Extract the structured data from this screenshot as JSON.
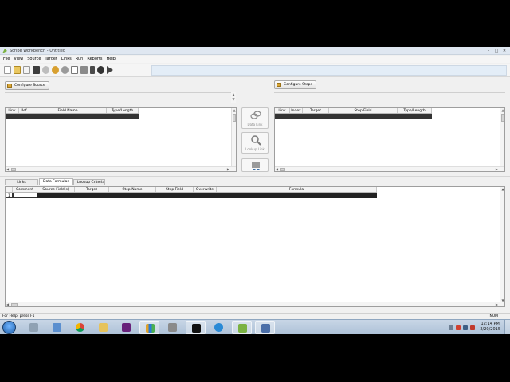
{
  "window": {
    "title": "Scribe Workbench - Untitled"
  },
  "menu": [
    "File",
    "View",
    "Source",
    "Target",
    "Links",
    "Run",
    "Reports",
    "Help"
  ],
  "toolbar": {
    "icons": [
      "new-icon",
      "open-icon",
      "open-recent-icon",
      "save-icon",
      "source-icon",
      "target-icon",
      "settings-icon",
      "report-icon",
      "print-icon",
      "flag-icon",
      "check-icon",
      "run-icon"
    ]
  },
  "source": {
    "configure_label": "Configure Source",
    "columns": [
      "Link",
      "Ref",
      "Field Name",
      "Type/Length"
    ]
  },
  "target": {
    "configure_label": "Configure Steps",
    "columns": [
      "Link",
      "Index",
      "Target",
      "Step Field",
      "Type/Length"
    ]
  },
  "center": {
    "data_link_label": "Data Link",
    "lookup_link_label": "Lookup Link"
  },
  "tabs": [
    {
      "label": "Links",
      "active": false
    },
    {
      "label": "Data Formulas",
      "active": true
    },
    {
      "label": "Lookup Criteria",
      "active": false
    }
  ],
  "formulas": {
    "columns": [
      "Comment",
      "Source Field(s)",
      "Target",
      "Step Name",
      "Step Field",
      "Overwrite",
      "Formula"
    ],
    "first_row_number": "1"
  },
  "status": {
    "help_text": "For Help, press F1",
    "num_indicator": "NUM"
  },
  "taskbar": {
    "time": "12:14 PM",
    "date": "2/20/2015",
    "apps": [
      "explorer-icon",
      "network-icon",
      "ie-icon",
      "chrome-icon",
      "folder-icon",
      "visual-studio-icon",
      "chart-app-icon",
      "network-tool-icon",
      "cmd-icon",
      "ie-blue-icon",
      "scribe-icon",
      "scribe-console-icon"
    ]
  },
  "colors": {
    "accent": "#3a6ea5",
    "title_bar": "#dfe7f1",
    "taskbar": "#aec2d8"
  }
}
